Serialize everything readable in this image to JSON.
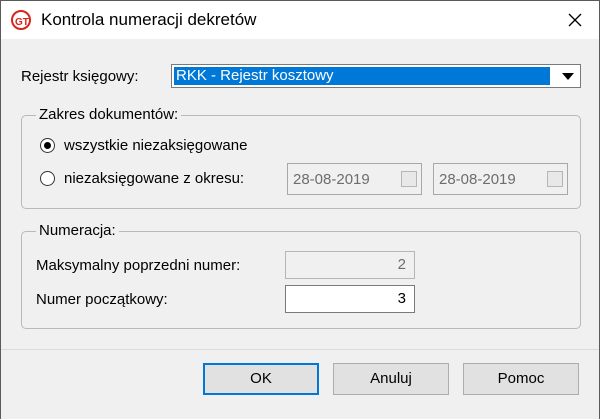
{
  "window": {
    "title": "Kontrola numeracji dekretów"
  },
  "rejestr": {
    "label": "Rejestr księgowy:",
    "value": "RKK - Rejestr kosztowy"
  },
  "zakres": {
    "legend": "Zakres dokumentów:",
    "option_all": "wszystkie niezaksięgowane",
    "option_period": "niezaksięgowane z okresu:",
    "selected": "option_all",
    "date_from": "28-08-2019",
    "date_to": "28-08-2019"
  },
  "numeracja": {
    "legend": "Numeracja:",
    "max_label": "Maksymalny poprzedni numer:",
    "max_value": "2",
    "start_label": "Numer początkowy:",
    "start_value": "3"
  },
  "buttons": {
    "ok": "OK",
    "cancel": "Anuluj",
    "help": "Pomoc"
  },
  "colors": {
    "selection": "#0078d7",
    "accent_red": "#d9241b"
  }
}
